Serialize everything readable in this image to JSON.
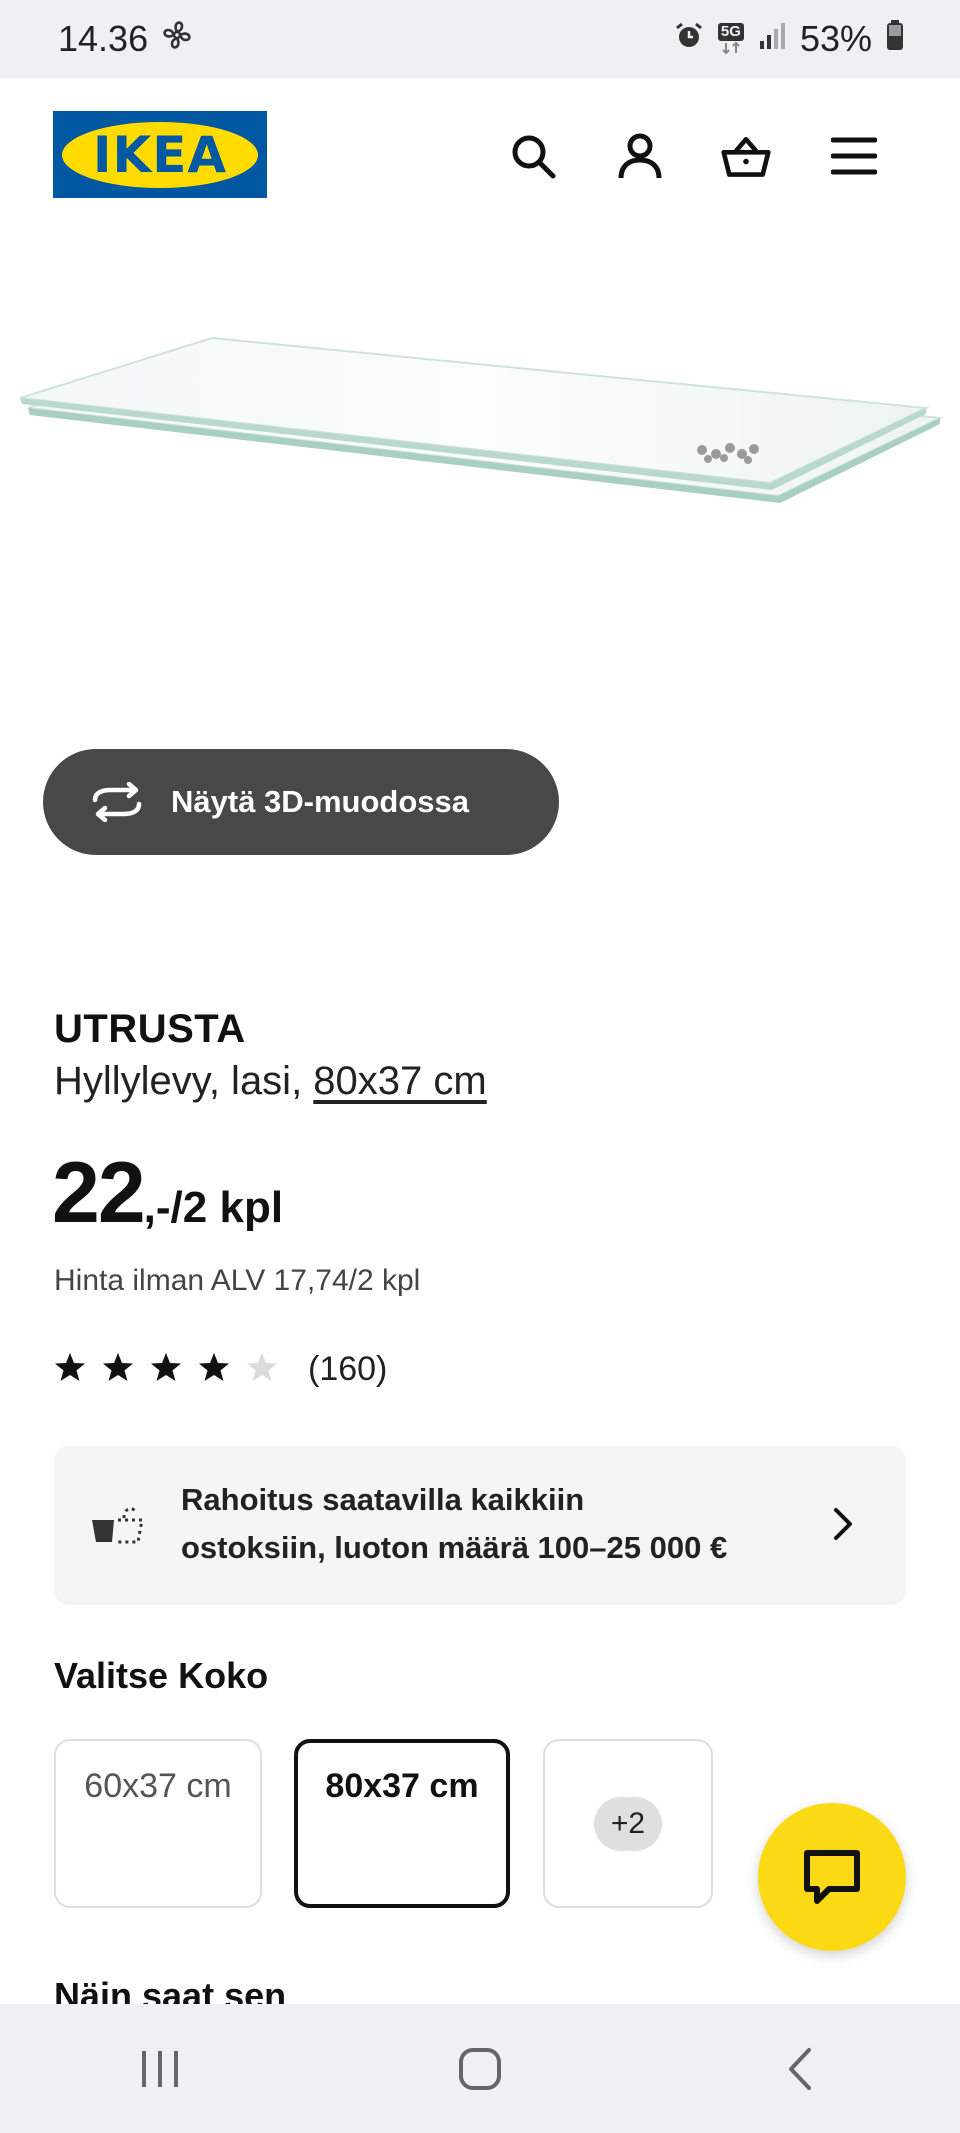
{
  "status_bar": {
    "time": "14.36",
    "network": "5G",
    "battery": "53%"
  },
  "header": {
    "logo_text": "IKEA"
  },
  "product": {
    "view_3d_label": "Näytä 3D-muodossa",
    "name": "UTRUSTA",
    "description_prefix": "Hyllylevy, lasi, ",
    "size_link": "80x37 cm",
    "price_integer": "22",
    "price_suffix": ",-/2 kpl",
    "price_without_vat": "Hinta ilman ALV 17,74/2 kpl",
    "rating_value": 4,
    "rating_max": 5,
    "rating_count": "(160)"
  },
  "financing": {
    "line1": "Rahoitus saatavilla kaikkiin",
    "line2": "ostoksiin, luoton määrä 100–25 000 €"
  },
  "size_selector": {
    "title": "Valitse Koko",
    "options": [
      {
        "label": "60x37 cm",
        "selected": false
      },
      {
        "label": "80x37 cm",
        "selected": true
      }
    ],
    "more_label": "+2"
  },
  "next_section_title": "Näin saat sen",
  "colors": {
    "ikea_blue": "#0058a3",
    "ikea_yellow": "#ffdb00",
    "chat_yellow": "#fbd914",
    "button_dark": "#484848"
  }
}
